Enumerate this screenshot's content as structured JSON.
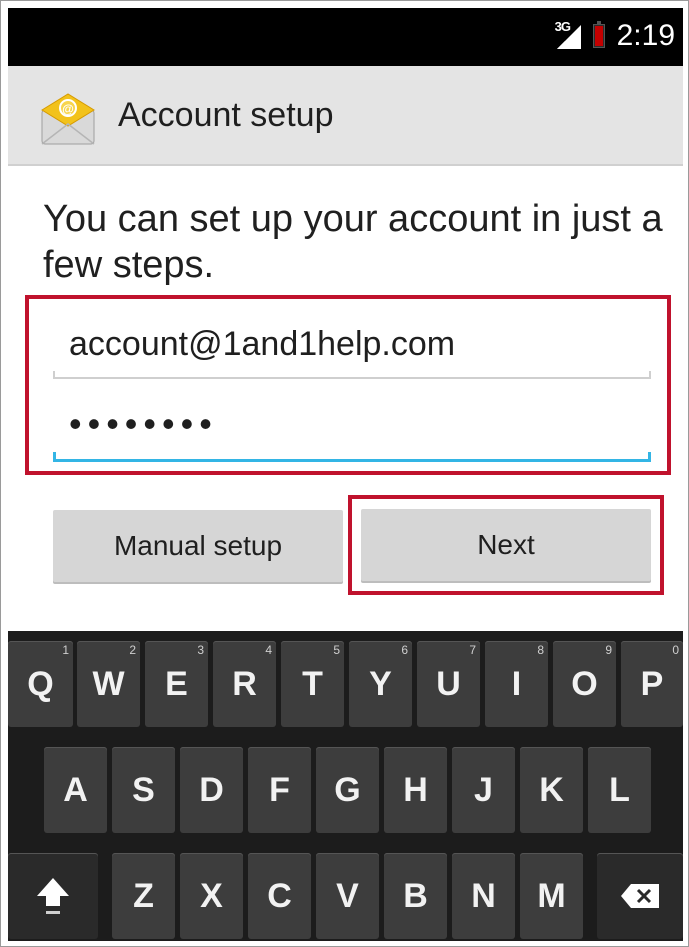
{
  "status_bar": {
    "network_label": "3G",
    "time": "2:19",
    "battery_color": "#c40000"
  },
  "action_bar": {
    "title": "Account setup",
    "icon": "email-app-icon"
  },
  "intro_text": "You can set up your account in just a few steps.",
  "form": {
    "email_value": "account@1and1help.com",
    "password_value": "••••••••",
    "accent_color": "#33b5e5"
  },
  "buttons": {
    "manual_setup": "Manual setup",
    "next": "Next"
  },
  "highlight_color": "#c0122d",
  "keyboard": {
    "row1": [
      {
        "label": "Q",
        "hint": "1"
      },
      {
        "label": "W",
        "hint": "2"
      },
      {
        "label": "E",
        "hint": "3"
      },
      {
        "label": "R",
        "hint": "4"
      },
      {
        "label": "T",
        "hint": "5"
      },
      {
        "label": "Y",
        "hint": "6"
      },
      {
        "label": "U",
        "hint": "7"
      },
      {
        "label": "I",
        "hint": "8"
      },
      {
        "label": "O",
        "hint": "9"
      },
      {
        "label": "P",
        "hint": "0"
      }
    ],
    "row2": [
      "A",
      "S",
      "D",
      "F",
      "G",
      "H",
      "J",
      "K",
      "L"
    ],
    "row3": [
      "Z",
      "X",
      "C",
      "V",
      "B",
      "N",
      "M"
    ],
    "shift_icon": "shift-icon",
    "backspace_icon": "backspace-icon"
  }
}
